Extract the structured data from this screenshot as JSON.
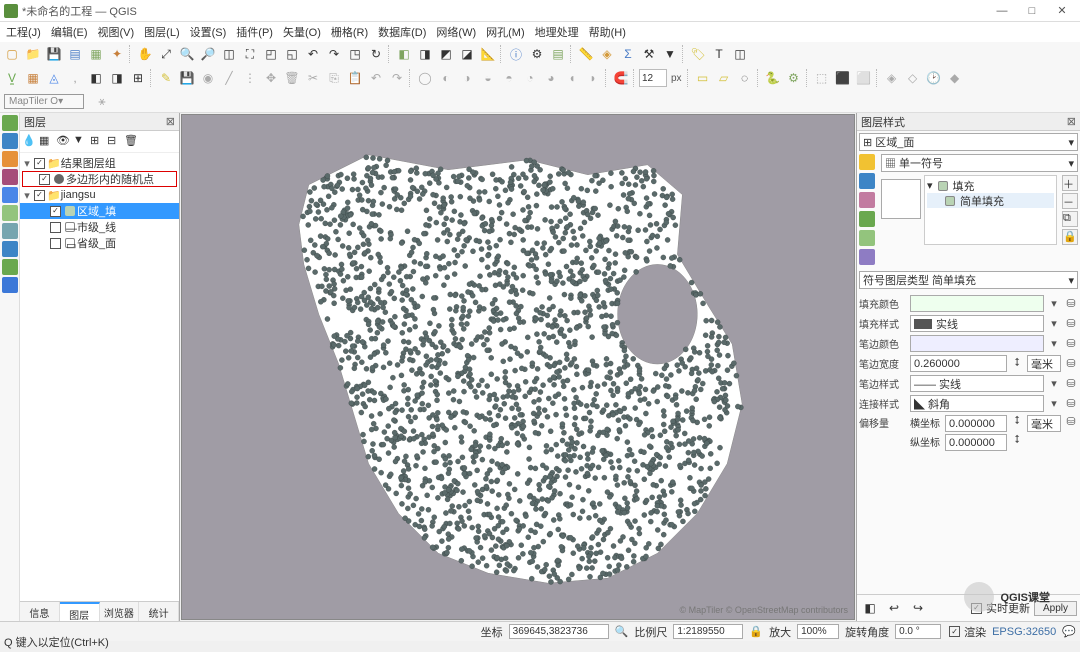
{
  "title": "*未命名的工程 — QGIS",
  "window_buttons": {
    "min": "—",
    "max": "□",
    "close": "✕"
  },
  "menu": [
    "工程(J)",
    "编辑(E)",
    "视图(V)",
    "图层(L)",
    "设置(S)",
    "插件(P)",
    "矢量(O)",
    "栅格(R)",
    "数据库(D)",
    "网络(W)",
    "网孔(M)",
    "地理处理",
    "帮助(H)"
  ],
  "maptiler_label": "MapTiler O▾",
  "panels": {
    "layers_title": "图层",
    "style_title": "图层样式",
    "layer_tabs": [
      "信息",
      "图层",
      "浏览器",
      "统计"
    ]
  },
  "layer_tree": {
    "group": "结果图层组",
    "random_points": "多边形内的随机点",
    "jiangsu": "jiangsu",
    "area_fill": "区域_填",
    "city_line": "市级_线",
    "prov_line": "省级_面"
  },
  "map_credits": "© MapTiler  © OpenStreetMap contributors",
  "style": {
    "top_combo": "⊞ 区域_面",
    "symbol_type": "▦ 单一符号",
    "tree_fill": "填充",
    "tree_simple_fill": "简单填充",
    "layer_render_type_label": "符号图层类型 简单填充",
    "fill_color": "填充颜色",
    "fill_style": "填充样式",
    "fill_style_val": "实线",
    "stroke_color": "笔边颜色",
    "stroke_width": "笔边宽度",
    "stroke_width_val": "0.260000",
    "stroke_width_unit": "毫米",
    "stroke_style": "笔边样式",
    "stroke_style_val": "—— 实线",
    "join_style": "连接样式",
    "join_style_val": "◣ 斜角",
    "offset_label": "偏移量",
    "offset_x_label": "横坐标",
    "offset_y_label": "纵坐标",
    "offset_x": "0.000000",
    "offset_y": "0.000000",
    "offset_unit": "毫米",
    "live_update": "实时更新",
    "apply": "Apply"
  },
  "status": {
    "quick_locate": "Q 键入以定位(Ctrl+K)",
    "coord_label": "坐标",
    "coord_val": "369645,3823736",
    "scale_label": "比例尺",
    "scale_val": "1:2189550",
    "mag_label": "放大",
    "mag_val": "100%",
    "rot_label": "旋转角度",
    "rot_val": "0.0 °",
    "render": "渲染",
    "crs": "EPSG:32650"
  },
  "colors": {
    "left_tool_icons": [
      "#6aa84f",
      "#3d85c6",
      "#e69138",
      "#a64d79",
      "#4a86e8",
      "#93c47d",
      "#76a5af",
      "#3d85c6",
      "#6aa84f",
      "#3c78d8"
    ],
    "right_side_icons": [
      "#f1c232",
      "#3d85c6",
      "#c27ba0",
      "#6aa84f",
      "#93c47d",
      "#8e7cc3"
    ]
  },
  "watermark": "QGIS课堂"
}
